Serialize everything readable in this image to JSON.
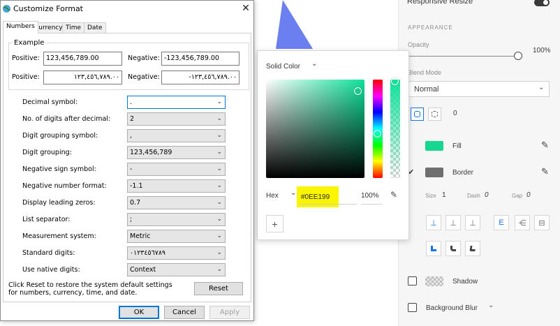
{
  "dialog": {
    "title": "Customize Format",
    "close_glyph": "✕",
    "tabs": [
      {
        "label": "Numbers",
        "active": true
      },
      {
        "label": "Currency",
        "active": false
      },
      {
        "label": "Time",
        "active": false
      },
      {
        "label": "Date",
        "active": false
      }
    ],
    "example": {
      "legend": "Example",
      "positive_label": "Positive:",
      "negative_label": "Negative:",
      "positive_latin": "123,456,789.00",
      "negative_latin": "-123,456,789.00",
      "positive_native": "١٢٣,٤٥٦,٧٨٩.٠٠",
      "negative_native": "-١٢٣,٤٥٦,٧٨٩.٠٠"
    },
    "settings": [
      {
        "label": "Decimal symbol:",
        "value": "."
      },
      {
        "label": "No. of digits after decimal:",
        "value": "2"
      },
      {
        "label": "Digit grouping symbol:",
        "value": ","
      },
      {
        "label": "Digit grouping:",
        "value": "123,456,789"
      },
      {
        "label": "Negative sign symbol:",
        "value": "-"
      },
      {
        "label": "Negative number format:",
        "value": "-1.1"
      },
      {
        "label": "Display leading zeros:",
        "value": "0.7"
      },
      {
        "label": "List separator:",
        "value": ";"
      },
      {
        "label": "Measurement system:",
        "value": "Metric"
      },
      {
        "label": "Standard digits:",
        "value": "٠١٢٣٤٥٦٧٨٩"
      },
      {
        "label": "Use native digits:",
        "value": "Context"
      }
    ],
    "reset_note": "Click Reset to restore the system default settings for numbers, currency, time, and date.",
    "reset_label": "Reset",
    "ok_label": "OK",
    "cancel_label": "Cancel",
    "apply_label": "Apply",
    "colors": {
      "focus": "#0078d7"
    }
  },
  "color_picker": {
    "mode": "Solid Color",
    "hex_label": "Hex",
    "hex_value": "#0EE199",
    "opacity_value": "100%",
    "add_glyph": "+",
    "colors": {
      "selected": "#0EE199",
      "highlight": "#FBF500"
    }
  },
  "panel": {
    "responsive_resize_label": "Responsive Resize",
    "appearance_label": "APPEARANCE",
    "opacity_label": "Opacity",
    "opacity_value": "100%",
    "blend_mode_label": "Blend Mode",
    "blend_mode_value": "Normal",
    "corner_radius_value": "0",
    "fill_label": "Fill",
    "border_label": "Border",
    "size_label": "Size",
    "size_value": "1",
    "dash_label": "Dash",
    "dash_value": "0",
    "gap_label": "Gap",
    "gap_value": "0",
    "shadow_label": "Shadow",
    "background_blur_label": "Background Blur",
    "colors": {
      "fill": "#17D68F",
      "border": "#6f6f6f",
      "accent": "#1473e6",
      "shape": "#6b7ff0"
    }
  }
}
